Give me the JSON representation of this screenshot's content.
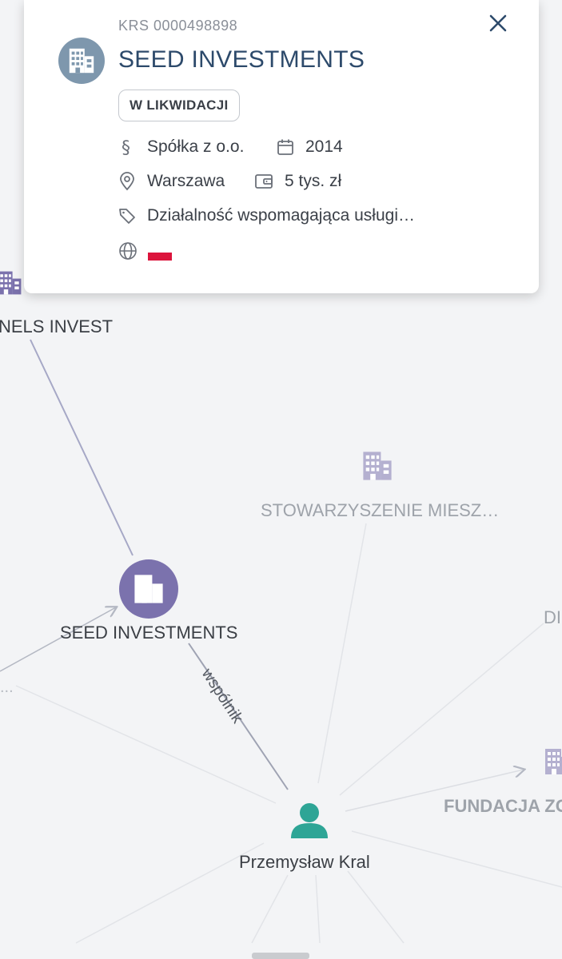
{
  "card": {
    "krs": "KRS 0000498898",
    "company_name": "SEED INVESTMENTS",
    "status_badge": "W LIKWIDACJI",
    "legal_form": "Spółka z o.o.",
    "year": "2014",
    "city": "Warszawa",
    "capital": "5 tys. zł",
    "activity": "Działalność wspomagająca usługi…",
    "flag_country": "Poland",
    "icons": [
      "building-icon",
      "close-icon",
      "section-icon",
      "calendar-icon",
      "location-pin-icon",
      "wallet-icon",
      "tag-icon",
      "globe-icon"
    ]
  },
  "graph": {
    "nodes": [
      {
        "label": "NELS INVEST",
        "icon": "building-icon"
      },
      {
        "label": "STOWARZYSZENIE MIESZ…",
        "icon": "building-icon"
      },
      {
        "label": "SEED INVESTMENTS",
        "icon": "building-icon"
      },
      {
        "label": "DI",
        "icon": "building-icon"
      },
      {
        "label": "FUNDACJA ZO",
        "icon": "building-icon"
      },
      {
        "label": "Przemysław Kral",
        "icon": "person-icon"
      }
    ],
    "edge_labels": {
      "seed_to_person": "wspólnik"
    }
  },
  "colors": {
    "company_node": "#7b72ad",
    "person_node": "#2ea596",
    "title_text": "#2d4a6b",
    "flag_red": "#dc143c"
  }
}
